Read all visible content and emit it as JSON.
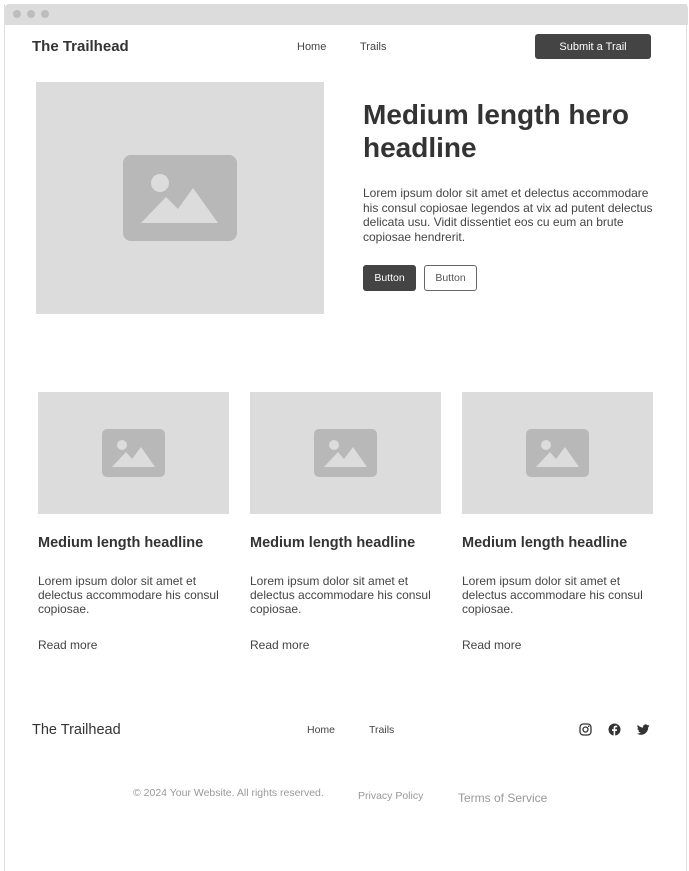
{
  "header": {
    "brand": "The Trailhead",
    "nav": [
      "Home",
      "Trails"
    ],
    "cta_label": "Submit a Trail"
  },
  "hero": {
    "title": "Medium length hero headline",
    "body": "Lorem ipsum dolor sit amet et delectus accommodare his consul copiosae legendos at vix ad putent delectus delicata usu. Vidit dissentiet eos cu eum an brute copiosae hendrerit.",
    "primary_button": "Button",
    "secondary_button": "Button",
    "image_icon": "image-placeholder-icon"
  },
  "cards": [
    {
      "title": "Medium length headline",
      "body": "Lorem ipsum dolor sit amet et delectus accommodare his consul copiosae.",
      "link": "Read more",
      "image_icon": "image-placeholder-icon"
    },
    {
      "title": "Medium length headline",
      "body": "Lorem ipsum dolor sit amet et delectus accommodare his consul copiosae.",
      "link": "Read more",
      "image_icon": "image-placeholder-icon"
    },
    {
      "title": "Medium length headline",
      "body": "Lorem ipsum dolor sit amet et delectus accommodare his consul copiosae.",
      "link": "Read more",
      "image_icon": "image-placeholder-icon"
    }
  ],
  "footer": {
    "brand": "The Trailhead",
    "nav": [
      "Home",
      "Trails"
    ],
    "social_icons": [
      "instagram-icon",
      "facebook-icon",
      "twitter-icon"
    ],
    "copyright": "© 2024 Your Website. All rights reserved.",
    "privacy_label": "Privacy Policy",
    "terms_label": "Terms of Service"
  },
  "colors": {
    "placeholder_bg": "#dcdcdc",
    "placeholder_icon": "#b8b8b8",
    "dark_button": "#444444",
    "muted_text": "#999999"
  }
}
